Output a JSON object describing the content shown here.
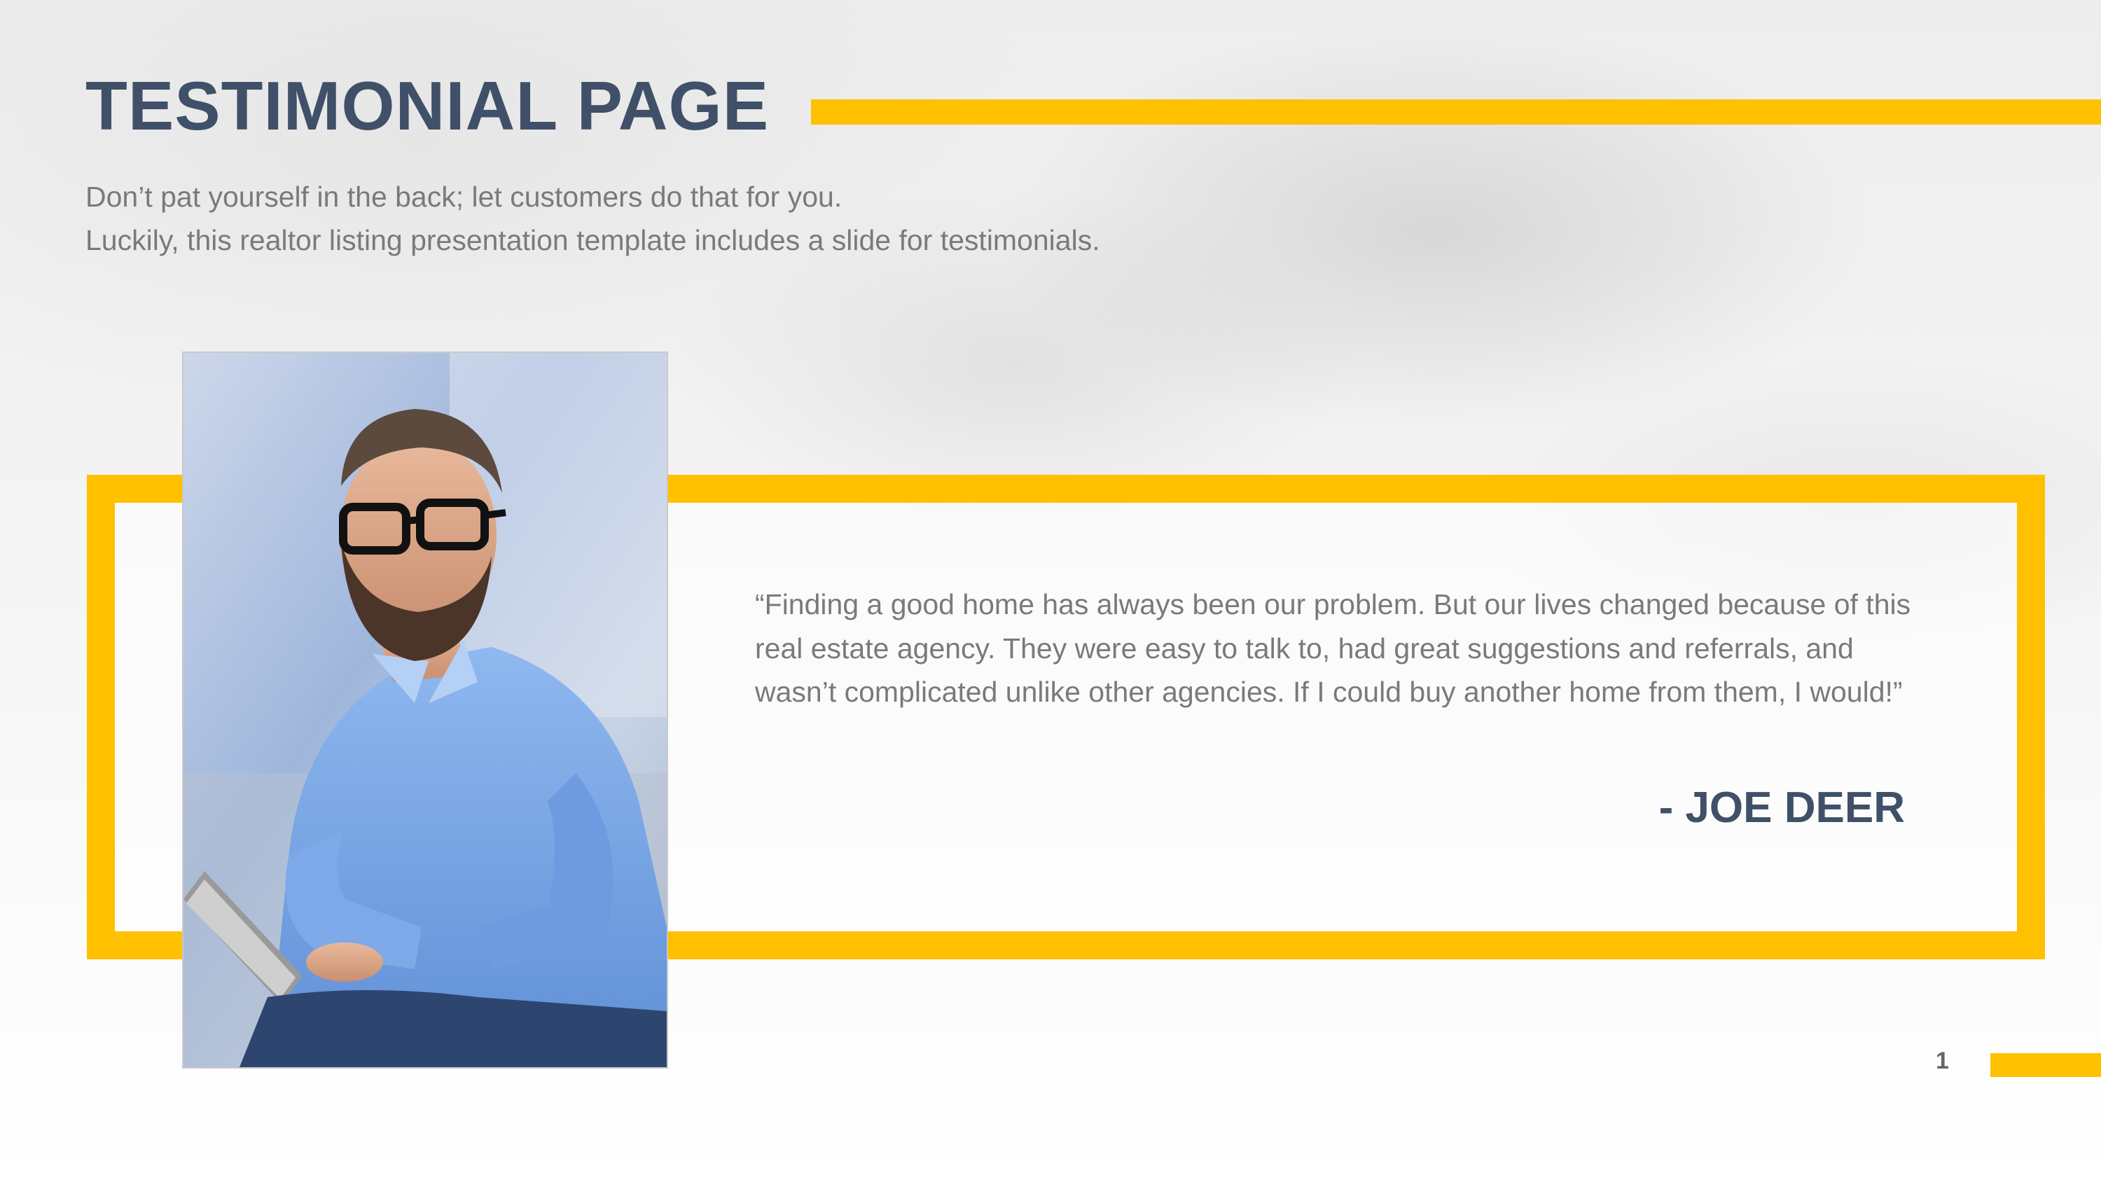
{
  "slide": {
    "title": "TESTIMONIAL PAGE",
    "subtitle_lines": [
      "Don’t pat yourself in the back; let customers do that for you.",
      "Luckily, this realtor listing presentation template includes a slide for testimonials."
    ],
    "testimonial": {
      "quote": "“Finding a good home has always been our problem. But our lives changed because of this real estate agency. They were easy to talk to, had great suggestions and referrals, and wasn’t complicated unlike other agencies. If I could buy another home from them, I would!”",
      "author": "- JOE DEER"
    },
    "page_number": "1"
  },
  "colors": {
    "accent": "#ffc000",
    "title": "#3f5068",
    "body_text": "#7a7a7a"
  }
}
